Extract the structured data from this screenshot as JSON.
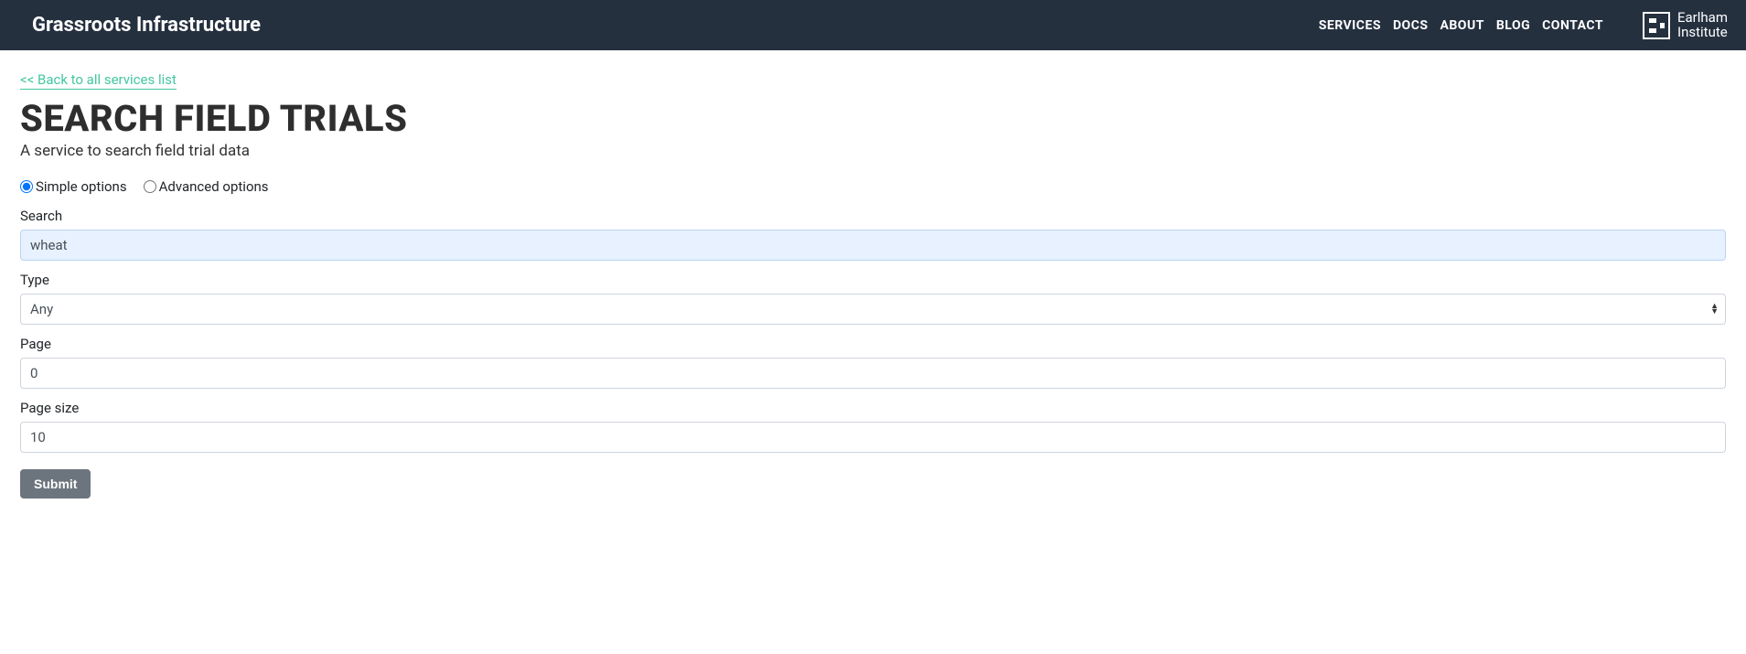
{
  "navbar": {
    "brand": "Grassroots Infrastructure",
    "links": {
      "services": "SERVICES",
      "docs": "DOCS",
      "about": "ABOUT",
      "blog": "BLOG",
      "contact": "CONTACT"
    },
    "logo_line1": "Earlham",
    "logo_line2": "Institute"
  },
  "back_link": "<< Back to all services list",
  "title": "SEARCH FIELD TRIALS",
  "subtitle": "A service to search field trial data",
  "options": {
    "simple": "Simple options",
    "advanced": "Advanced options"
  },
  "form": {
    "search_label": "Search",
    "search_value": "wheat",
    "type_label": "Type",
    "type_value": "Any",
    "page_label": "Page",
    "page_value": "0",
    "page_size_label": "Page size",
    "page_size_value": "10",
    "submit": "Submit"
  }
}
